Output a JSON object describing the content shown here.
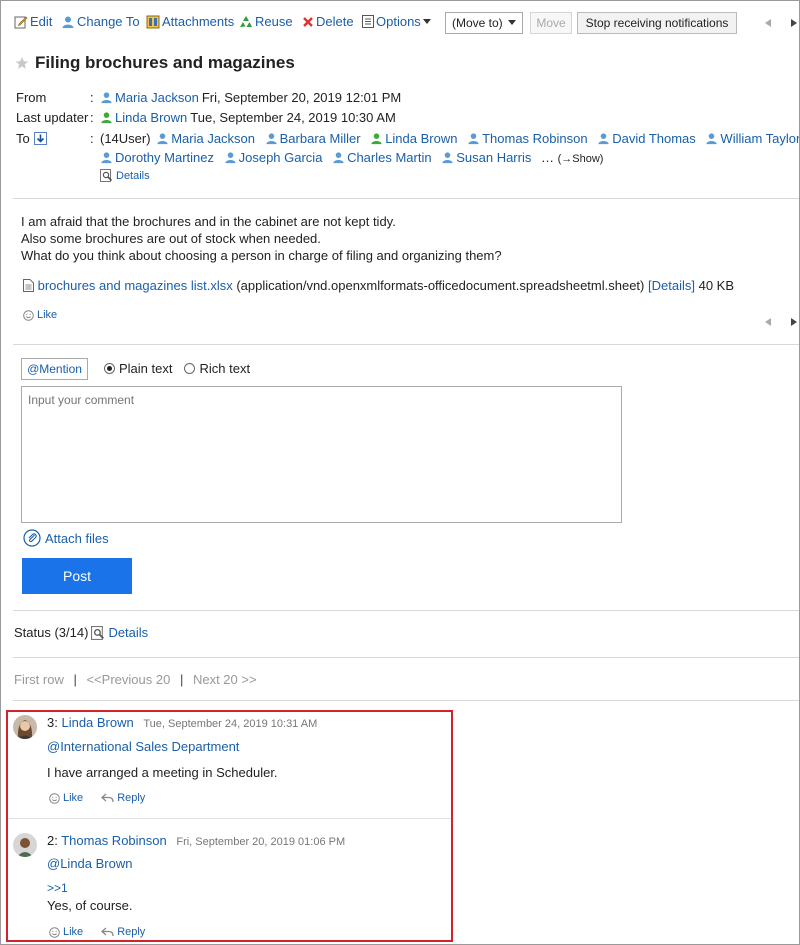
{
  "toolbar": {
    "edit": "Edit",
    "change_to": "Change To",
    "attachments": "Attachments",
    "reuse": "Reuse",
    "delete": "Delete",
    "options": "Options",
    "move_to_select": "(Move to)",
    "move_button": "Move",
    "stop_notifications": "Stop receiving notifications"
  },
  "message": {
    "title": "Filing brochures and magazines",
    "from_label": "From",
    "from_user": "Maria Jackson",
    "from_date": "Fri, September 20, 2019 12:01 PM",
    "last_updater_label": "Last updater",
    "updater_user": "Linda Brown",
    "updater_date": "Tue, September 24, 2019 10:30 AM",
    "to_label": "To",
    "recipient_count": "(14User)",
    "recipients_row1": [
      "Maria Jackson",
      "Barbara Miller",
      "Linda Brown",
      "Thomas Robinson",
      "David Thomas",
      "William Taylor"
    ],
    "recipients_row2": [
      "Dorothy Martinez",
      "Joseph Garcia",
      "Charles Martin",
      "Susan Harris"
    ],
    "ellipsis": "…",
    "show_link": "(→Show)",
    "details_link": "Details",
    "body_lines": [
      "I am afraid that the brochures and  in the cabinet are not kept tidy.",
      "Also some brochures are out of stock when needed.",
      "What do you think about choosing a person in charge of filing and organizing them?"
    ],
    "attachment_name": "brochures and magazines list.xlsx",
    "attachment_type": "(application/vnd.openxmlformats-officedocument.spreadsheetml.sheet)",
    "attachment_details": "[Details]",
    "attachment_size": "40 KB",
    "like": "Like"
  },
  "compose": {
    "mention": "@Mention",
    "plain_text": "Plain text",
    "rich_text": "Rich text",
    "placeholder": "Input your comment",
    "attach_files": "Attach files",
    "post": "Post"
  },
  "status": {
    "label": "Status (3/14)",
    "details": "Details"
  },
  "pager": {
    "first_row": "First row",
    "sep": "|",
    "previous": "<<Previous 20",
    "next": "Next 20 >>"
  },
  "comments": [
    {
      "number": "3:",
      "author": "Linda Brown",
      "date": "Tue, September 24, 2019 10:31 AM",
      "mention": "@International Sales Department",
      "text": "I have arranged a meeting in Scheduler.",
      "like": "Like",
      "reply": "Reply"
    },
    {
      "number": "2:",
      "author": "Thomas Robinson",
      "date": "Fri, September 20, 2019 01:06 PM",
      "mention": "@Linda Brown",
      "reference": ">>1",
      "text": "Yes, of course.",
      "like": "Like",
      "reply": "Reply"
    }
  ],
  "colors": {
    "link": "#1a5fa8",
    "post_button": "#1a73e8",
    "highlight_border": "#d2232a"
  }
}
